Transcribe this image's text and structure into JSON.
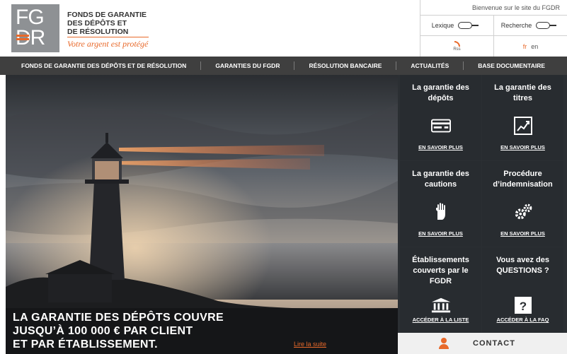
{
  "logo": {
    "line1": "FG",
    "line2": "DR",
    "org_name_1": "FONDS DE GARANTIE",
    "org_name_2": "DES DÉPÔTS ET",
    "org_name_3": "DE RÉSOLUTION",
    "tagline": "Votre argent est protégé"
  },
  "util": {
    "welcome": "Bienvenue sur le site du FGDR",
    "lexique": "Lexique",
    "recherche": "Recherche",
    "rss": "Rss",
    "lang_fr": "fr",
    "lang_en": "en"
  },
  "nav": [
    "FONDS DE GARANTIE DES DÉPÔTS ET DE RÉSOLUTION",
    "GARANTIES DU FGDR",
    "RÉSOLUTION BANCAIRE",
    "ACTUALITÉS",
    "BASE DOCUMENTAIRE"
  ],
  "hero": {
    "line1": "LA GARANTIE DES DÉPÔTS COUVRE",
    "line2": "JUSQU’À 100 000 € PAR CLIENT",
    "line3": "ET PAR ÉTABLISSEMENT.",
    "link": "Lire la suite"
  },
  "tiles": [
    {
      "title": "La garantie des dépôts",
      "link": "EN SAVOIR PLUS",
      "icon": "card-icon"
    },
    {
      "title": "La garantie des titres",
      "link": "EN SAVOIR PLUS",
      "icon": "chart-icon"
    },
    {
      "title": "La garantie des cautions",
      "link": "EN SAVOIR PLUS",
      "icon": "hand-icon"
    },
    {
      "title": "Procédure d’indemnisation",
      "link": "EN SAVOIR PLUS",
      "icon": "gears-icon"
    },
    {
      "title": "Établissements couverts par le FGDR",
      "link": "ACCÉDER À LA LISTE",
      "icon": "bank-icon"
    },
    {
      "title": "Vous avez des QUESTIONS ?",
      "link": "ACCÉDER À LA FAQ",
      "icon": "question-icon"
    }
  ],
  "contact": {
    "label": "CONTACT"
  },
  "colors": {
    "accent": "#e8692a",
    "nav_bg": "#3f3f3f",
    "tile_bg": "#2b2f33"
  }
}
